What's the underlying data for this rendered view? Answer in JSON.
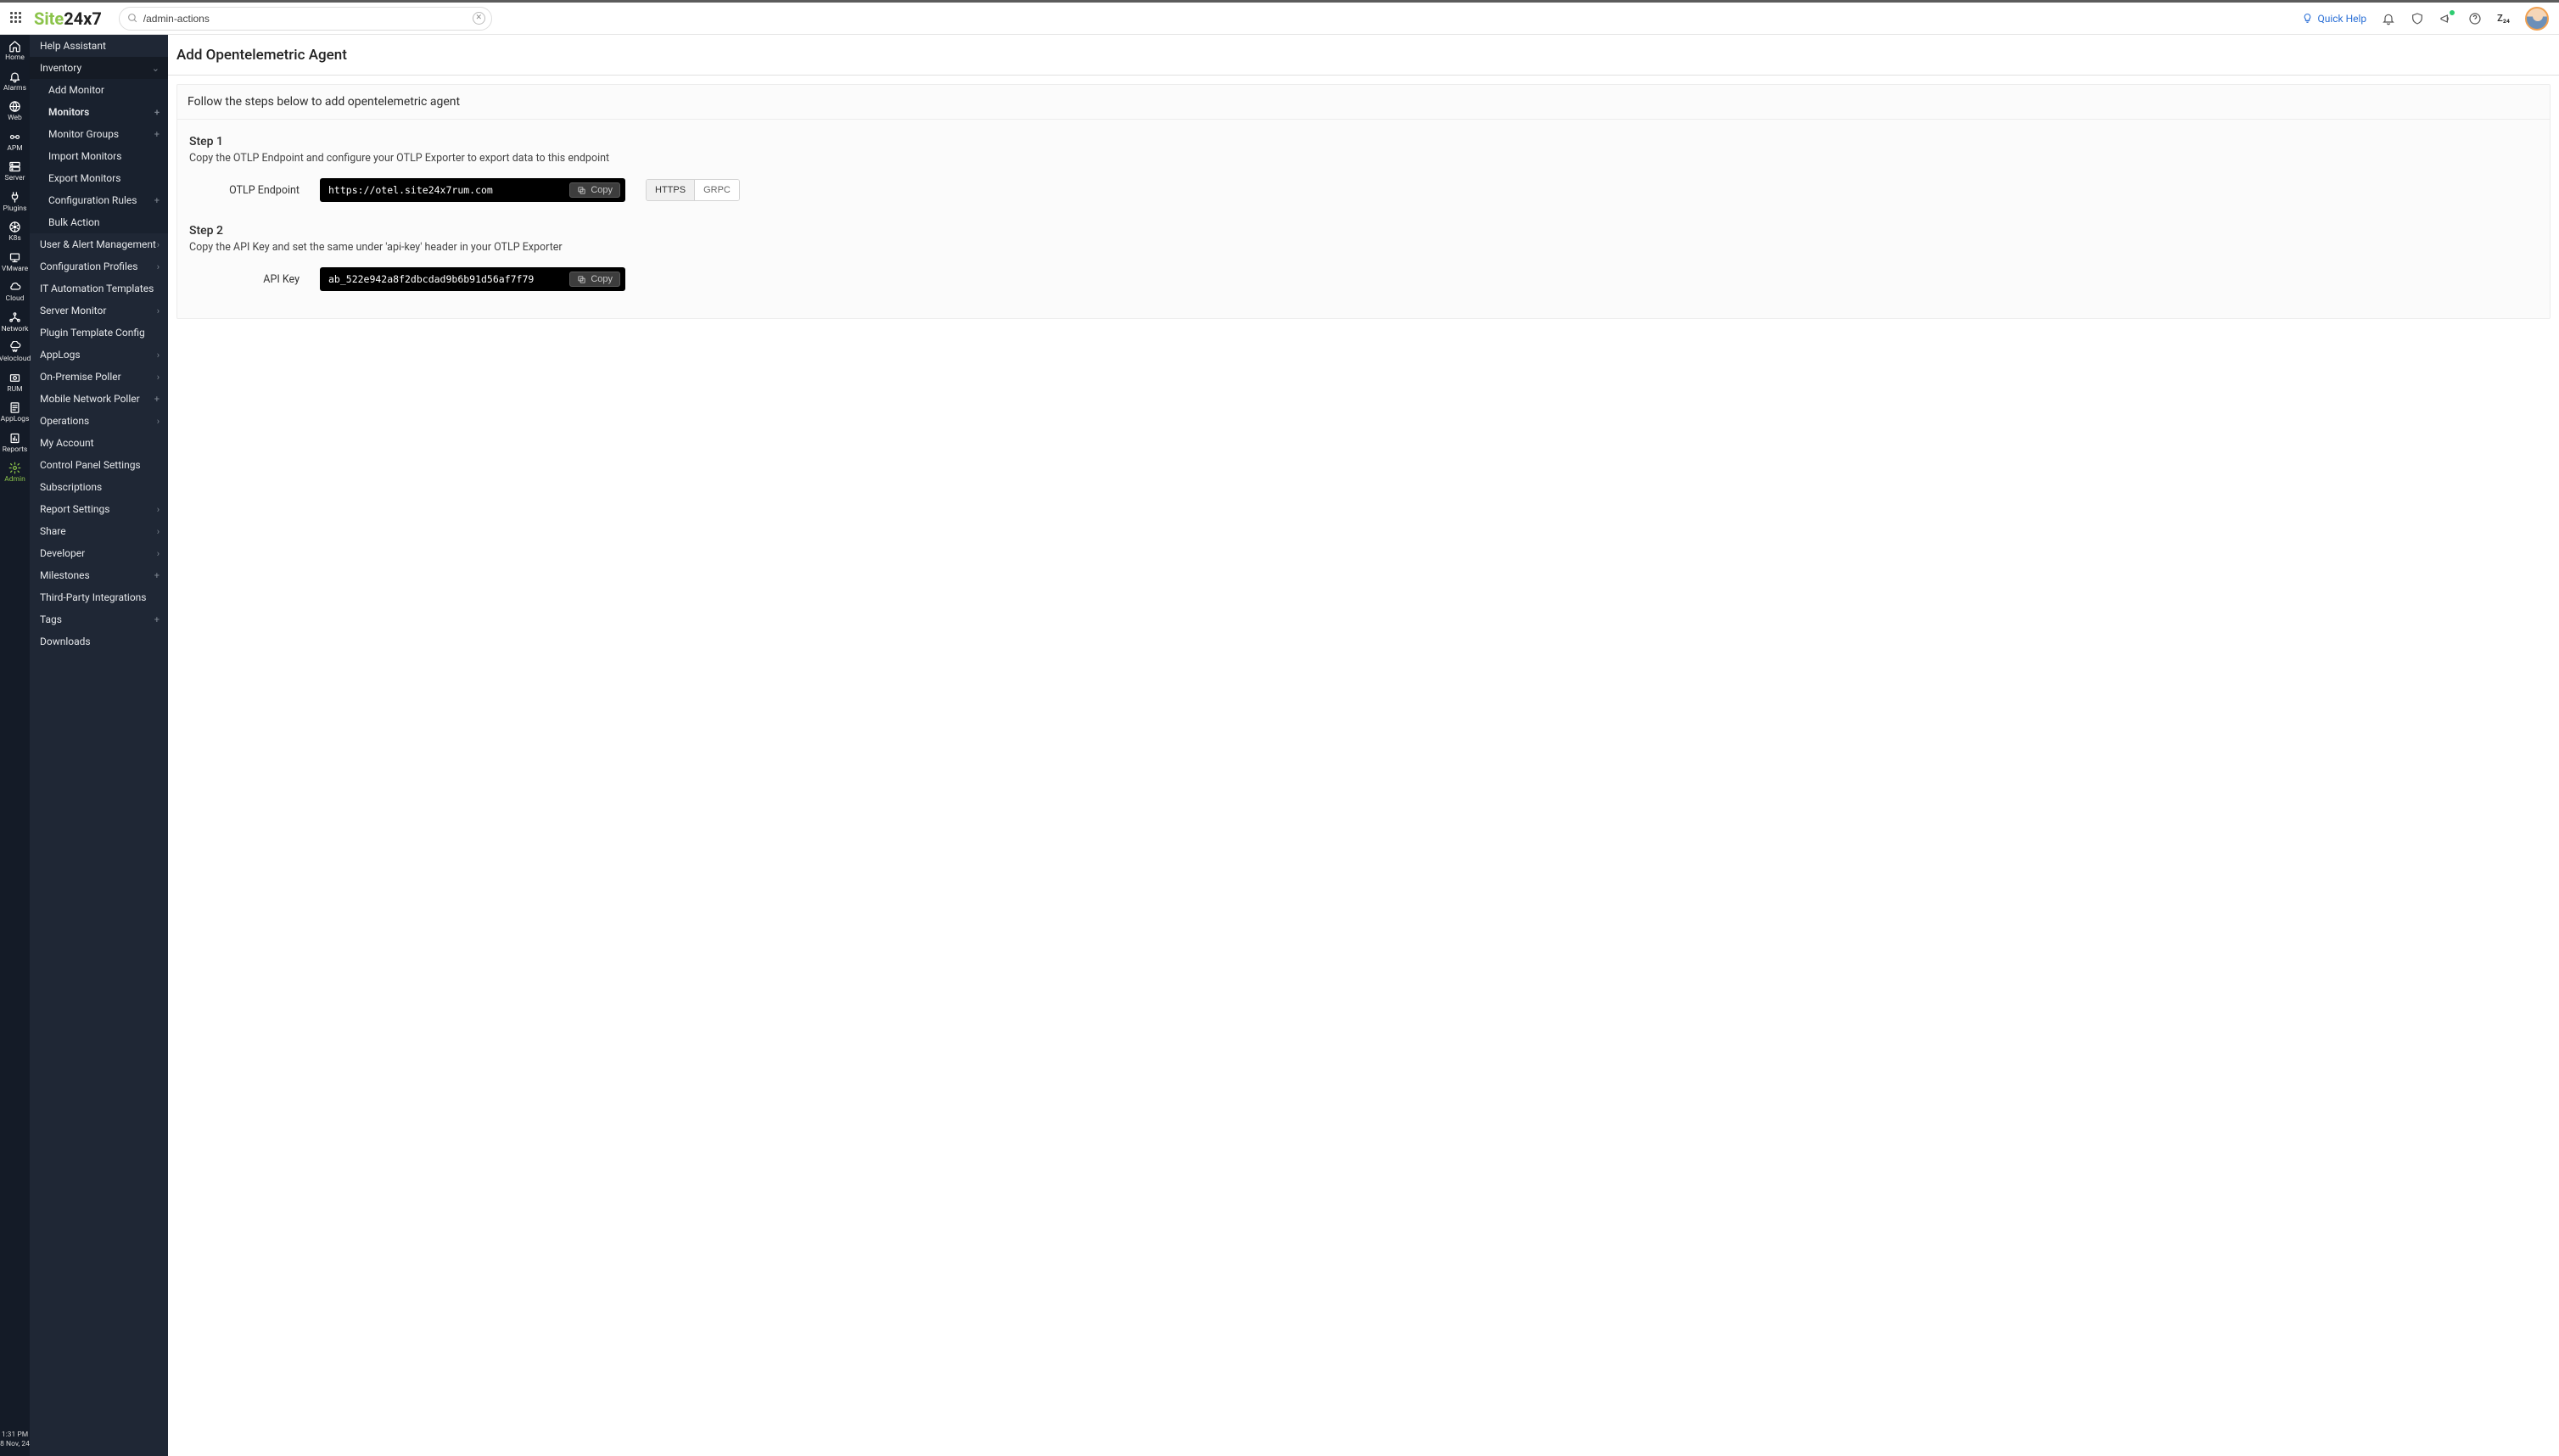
{
  "brand": {
    "text": "Site24x7",
    "green": "Site",
    "dark": "24x7"
  },
  "search": {
    "value": "/admin-actions"
  },
  "header": {
    "quick_help": "Quick Help",
    "z_badge": "Z₂₄"
  },
  "rail": [
    {
      "label": "Home",
      "icon": "home"
    },
    {
      "label": "Alarms",
      "icon": "bell"
    },
    {
      "label": "Web",
      "icon": "globe"
    },
    {
      "label": "APM",
      "icon": "link"
    },
    {
      "label": "Server",
      "icon": "server"
    },
    {
      "label": "Plugins",
      "icon": "plug"
    },
    {
      "label": "K8s",
      "icon": "k8s"
    },
    {
      "label": "VMware",
      "icon": "vmware"
    },
    {
      "label": "Cloud",
      "icon": "cloud"
    },
    {
      "label": "Network",
      "icon": "network"
    },
    {
      "label": "Velocloud",
      "icon": "velo"
    },
    {
      "label": "RUM",
      "icon": "rum"
    },
    {
      "label": "AppLogs",
      "icon": "logs"
    },
    {
      "label": "Reports",
      "icon": "reports"
    },
    {
      "label": "Admin",
      "icon": "gear",
      "active": true
    }
  ],
  "rail_footer": {
    "time": "1:31 PM",
    "date": "8 Nov, 24"
  },
  "nav": {
    "help_assistant": "Help Assistant",
    "inventory": "Inventory",
    "inventory_children": [
      {
        "label": "Add Monitor"
      },
      {
        "label": "Monitors",
        "selected": true,
        "plus": true
      },
      {
        "label": "Monitor Groups",
        "plus": true
      },
      {
        "label": "Import Monitors"
      },
      {
        "label": "Export Monitors"
      },
      {
        "label": "Configuration Rules",
        "plus": true
      },
      {
        "label": "Bulk Action"
      }
    ],
    "items": [
      {
        "label": "User & Alert Management",
        "chev": true
      },
      {
        "label": "Configuration Profiles",
        "chev": true
      },
      {
        "label": "IT Automation Templates"
      },
      {
        "label": "Server Monitor",
        "chev": true
      },
      {
        "label": "Plugin Template Config"
      },
      {
        "label": "AppLogs",
        "chev": true
      },
      {
        "label": "On-Premise Poller",
        "chev": true
      },
      {
        "label": "Mobile Network Poller",
        "plus": true
      },
      {
        "label": "Operations",
        "chev": true
      },
      {
        "label": "My Account"
      },
      {
        "label": "Control Panel Settings"
      },
      {
        "label": "Subscriptions"
      },
      {
        "label": "Report Settings",
        "chev": true
      },
      {
        "label": "Share",
        "chev": true
      },
      {
        "label": "Developer",
        "chev": true
      },
      {
        "label": "Milestones",
        "plus": true
      },
      {
        "label": "Third-Party Integrations"
      },
      {
        "label": "Tags",
        "plus": true
      },
      {
        "label": "Downloads"
      }
    ]
  },
  "page": {
    "title": "Add Opentelemetric Agent",
    "intro": "Follow the steps below to add opentelemetric agent",
    "step1": {
      "title": "Step 1",
      "desc": "Copy the OTLP Endpoint and configure your OTLP Exporter to export data to this endpoint",
      "label": "OTLP Endpoint",
      "value": "https://otel.site24x7rum.com",
      "copy": "Copy",
      "toggle": {
        "https": "HTTPS",
        "grpc": "GRPC"
      }
    },
    "step2": {
      "title": "Step 2",
      "desc": "Copy the API Key and set the same under 'api-key' header in your OTLP Exporter",
      "label": "API Key",
      "value": "ab_522e942a8f2dbcdad9b6b91d56af7f79",
      "copy": "Copy"
    }
  }
}
